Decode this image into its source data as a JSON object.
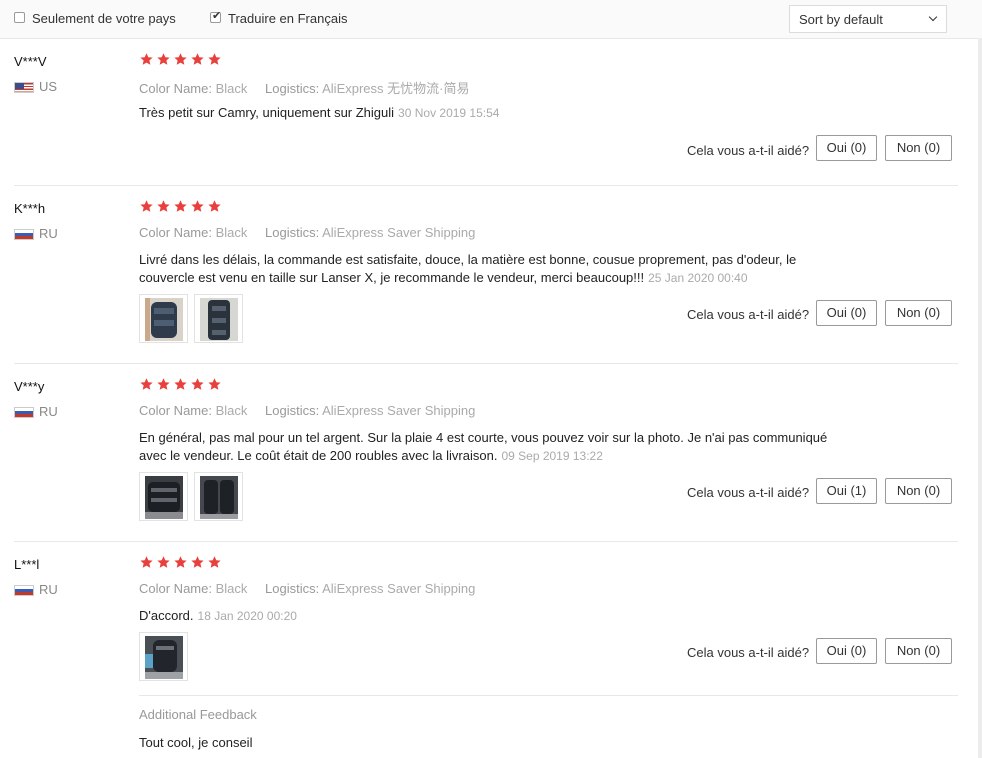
{
  "filters": {
    "local_only_label": "Seulement de votre pays",
    "local_only_checked": false,
    "translate_label": "Traduire en Français",
    "translate_checked": true,
    "sort_value": "Sort by default"
  },
  "labels": {
    "color_key": "Color Name:",
    "logistics_key": "Logistics:",
    "helpful_question": "Cela vous a-t-il aidé?"
  },
  "rating_color": "#e8413d",
  "reviews": [
    {
      "user": "V***V",
      "country": "US",
      "rating": 5,
      "color": "Black",
      "logistics": "AliExpress 无忧物流·简易",
      "text": "Très petit sur Camry, uniquement sur Zhiguli",
      "date": "30 Nov 2019 15:54",
      "yes": "Oui (0)",
      "no": "Non (0)"
    },
    {
      "user": "K***h",
      "country": "RU",
      "rating": 5,
      "color": "Black",
      "logistics": "AliExpress Saver Shipping",
      "text": "Livré dans les délais, la commande est satisfaite, douce, la matière est bonne, cousue proprement, pas d'odeur, le couvercle est venu en taille sur Lanser X, je recommande le vendeur, merci beaucoup!!!",
      "date": "25 Jan 2020 00:40",
      "yes": "Oui (0)",
      "no": "Non (0)"
    },
    {
      "user": "V***y",
      "country": "RU",
      "rating": 5,
      "color": "Black",
      "logistics": "AliExpress Saver Shipping",
      "text": "En général, pas mal pour un tel argent. Sur la plaie 4 est courte, vous pouvez voir sur la photo. Je n'ai pas communiqué avec le vendeur. Le coût était de 200 roubles avec la livraison.",
      "date": "09 Sep 2019 13:22",
      "yes": "Oui (1)",
      "no": "Non (0)"
    },
    {
      "user": "L***l",
      "country": "RU",
      "rating": 5,
      "color": "Black",
      "logistics": "AliExpress Saver Shipping",
      "text": "D'accord.",
      "date": "18 Jan 2020 00:20",
      "yes": "Oui (0)",
      "no": "Non (0)",
      "additional_title": "Additional Feedback",
      "additional_text": "Tout cool, je conseil"
    }
  ]
}
